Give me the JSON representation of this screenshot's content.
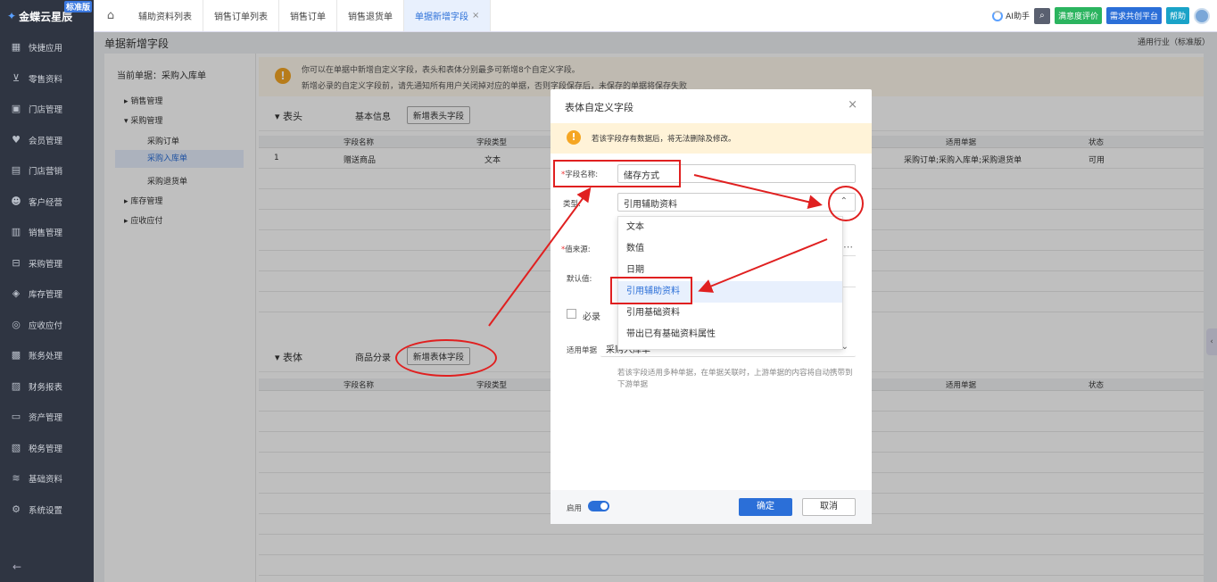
{
  "app": {
    "logo_text": "金蝶云星辰",
    "edition_badge": "标准版"
  },
  "sidebar": {
    "items": [
      {
        "label": "快捷应用",
        "icon": "apps-icon"
      },
      {
        "label": "零售资料",
        "icon": "basket-icon"
      },
      {
        "label": "门店管理",
        "icon": "store-icon"
      },
      {
        "label": "会员管理",
        "icon": "member-icon"
      },
      {
        "label": "门店营销",
        "icon": "marketing-icon"
      },
      {
        "label": "客户经营",
        "icon": "customer-icon"
      },
      {
        "label": "销售管理",
        "icon": "sales-icon"
      },
      {
        "label": "采购管理",
        "icon": "purchase-icon"
      },
      {
        "label": "库存管理",
        "icon": "inventory-icon"
      },
      {
        "label": "应收应付",
        "icon": "payable-icon"
      },
      {
        "label": "账务处理",
        "icon": "accounting-icon"
      },
      {
        "label": "财务报表",
        "icon": "report-icon"
      },
      {
        "label": "资产管理",
        "icon": "asset-icon"
      },
      {
        "label": "税务管理",
        "icon": "tax-icon"
      },
      {
        "label": "基础资料",
        "icon": "layers-icon"
      },
      {
        "label": "系统设置",
        "icon": "settings-icon"
      }
    ],
    "collapse_glyph": "←"
  },
  "topbar": {
    "tabs": [
      {
        "label": "辅助资料列表"
      },
      {
        "label": "销售订单列表"
      },
      {
        "label": "销售订单"
      },
      {
        "label": "销售退货单"
      },
      {
        "label": "单据新增字段"
      }
    ],
    "close_glyph": "×",
    "ai_label": "AI助手",
    "satisfaction": "满意度评价",
    "demand": "需求共创平台",
    "help": "帮助"
  },
  "page": {
    "title": "单据新增字段",
    "industry": "通用行业（标准版）",
    "current_doc": "当前单据：采购入库单",
    "tree": {
      "sales": "销售管理",
      "purchase": "采购管理",
      "po": "采购订单",
      "receipt": "采购入库单",
      "return": "采购退货单",
      "inventory": "库存管理",
      "ar_ap": "应收应付"
    },
    "notice": {
      "line1": "你可以在单据中新增自定义字段，表头和表体分别最多可新增8个自定义字段。",
      "line2": "新增必录的自定义字段前，请先通知所有用户关闭掉对应的单据，否则字段保存后，未保存的单据将保存失败"
    },
    "header_section": {
      "title": "表头",
      "subtitle": "基本信息",
      "add_button": "新增表头字段"
    },
    "body_section": {
      "title": "表体",
      "subtitle": "商品分录",
      "add_button": "新增表体字段"
    },
    "columns": {
      "name": "字段名称",
      "type": "字段类型",
      "applies": "适用单据",
      "status": "状态"
    },
    "header_rows": [
      {
        "no": "1",
        "name": "赠送商品",
        "type": "文本",
        "applies": "采购订单;采购入库单;采购退货单",
        "status": "可用"
      }
    ]
  },
  "modal": {
    "title": "表体自定义字段",
    "close_glyph": "×",
    "warning": "若该字段存有数据后，将无法删除及修改。",
    "field_name_label": "字段名称:",
    "field_name_value": "储存方式",
    "type_label": "类型:",
    "type_value": "引用辅助资料",
    "source_label": "值来源:",
    "default_label": "默认值:",
    "required_label": "必录",
    "applies_label": "适用单据",
    "applies_value": "采购入库单",
    "hint": "若该字段适用多种单据，在单据关联时，上游单据的内容将自动携带到下游单据",
    "options": [
      "文本",
      "数值",
      "日期",
      "引用辅助资料",
      "引用基础资料",
      "带出已有基础资料属性"
    ],
    "selected_option": "引用辅助资料",
    "enable_label": "启用",
    "ok": "确定",
    "cancel": "取消"
  },
  "colors": {
    "accent": "#2b6fd8",
    "annotation": "#e02020",
    "warning": "#f5a623"
  }
}
